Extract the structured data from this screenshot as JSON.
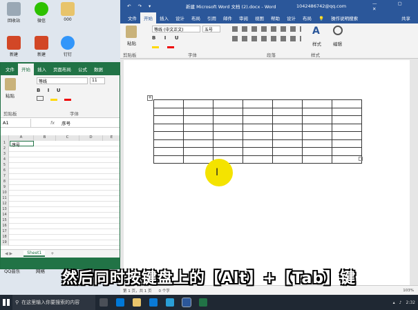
{
  "desktop": {
    "icons": [
      {
        "label": "回收站",
        "color": "#9aa8b5"
      },
      {
        "label": "微信",
        "color": "#2dc100"
      },
      {
        "label": "000",
        "color": "#e8c46b"
      },
      {
        "label": "新建",
        "color": "#d24726"
      },
      {
        "label": "新建",
        "color": "#d24726"
      },
      {
        "label": "钉钉",
        "color": "#3296fa"
      }
    ],
    "bottom_labels": [
      "QQ音乐",
      "网络"
    ]
  },
  "excel": {
    "tabs": [
      "文件",
      "开始",
      "插入",
      "页面布局",
      "公式",
      "数据"
    ],
    "active_tab": "开始",
    "ribbon": {
      "paste": "粘贴",
      "clipboard": "剪贴板",
      "font_name": "等线",
      "font_size": "11",
      "font_group": "字体"
    },
    "name_box": "A1",
    "formula_value": "序号",
    "fx": "fx",
    "columns": [
      "A",
      "B",
      "C",
      "D",
      "E"
    ],
    "rows": [
      "1",
      "2",
      "3",
      "4",
      "5",
      "6",
      "7",
      "8",
      "9",
      "10",
      "11",
      "12",
      "13",
      "14",
      "15",
      "16",
      "17",
      "18",
      "19"
    ],
    "cell_a1": "序号",
    "sheet_tab": "Sheet1",
    "add_sheet": "+",
    "accent": "#217346"
  },
  "word": {
    "title": "新建 Microsoft Word 文档 (2).docx - Word",
    "account": "1042486742@qq.com",
    "tabs": [
      "文件",
      "开始",
      "插入",
      "设计",
      "布局",
      "引用",
      "邮件",
      "审阅",
      "视图",
      "帮助",
      "设计",
      "布局"
    ],
    "active_tab": "开始",
    "tell_me": "操作说明搜索",
    "share": "共享",
    "ribbon": {
      "paste": "粘贴",
      "clipboard": "剪贴板",
      "font_name": "等线 (中文正文)",
      "font_size": "五号",
      "font_group": "字体",
      "paragraph_group": "段落",
      "styles": "样式",
      "styles_group": "样式",
      "edit": "编辑"
    },
    "status": {
      "page": "第 1 页，共 1 页",
      "words": "0 个字",
      "zoom": "103%"
    },
    "table": {
      "rows": 8,
      "cols": 7
    },
    "accent": "#2b579a"
  },
  "caption": "然后同时按键盘上的【Alt】+【Tab】键",
  "taskbar": {
    "search_placeholder": "在这里输入你要搜索的内容",
    "time": "2:32"
  }
}
